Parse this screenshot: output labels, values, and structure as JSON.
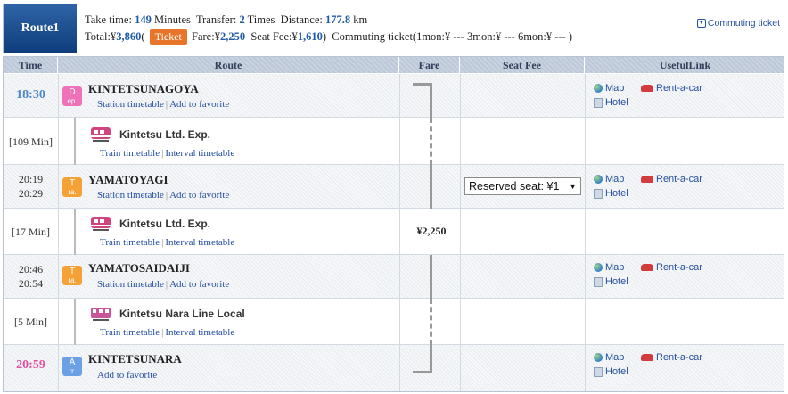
{
  "header": {
    "route_label": "Route1",
    "take_time_label": "Take time:",
    "take_time_value": "149",
    "minutes_label": "Minutes",
    "transfer_label": "Transfer:",
    "transfer_value": "2",
    "times_label": "Times",
    "distance_label": "Distance:",
    "distance_value": "177.8",
    "km_label": "km",
    "total_label": "Total:¥",
    "total_value": "3,860",
    "paren_open": "(",
    "ticket_button": "Ticket",
    "fare_label": "Fare:¥",
    "fare_value": "2,250",
    "seat_fee_label": "Seat Fee:¥",
    "seat_fee_value": "1,610",
    "paren_close": ")",
    "commuting_text": "Commuting ticket(1mon:¥ ---     3mon:¥ ---     6mon:¥ --- )",
    "commuting_link": "Commuting ticket"
  },
  "columns": [
    "Time",
    "Route",
    "Fare",
    "Seat Fee",
    "UsefulLink"
  ],
  "rows": {
    "dep": {
      "time": "18:30",
      "icon_top": "D",
      "icon_bottom": "ep.",
      "name": "KINTETSUNAGOYA",
      "link1": "Station timetable",
      "link2": "Add to favorite"
    },
    "t1": {
      "duration": "[109 Min]",
      "train": "Kintetsu Ltd. Exp.",
      "link1": "Train timetable",
      "link2": "Interval timetable"
    },
    "s2": {
      "time_arr": "20:19",
      "time_dep": "20:29",
      "icon_top": "T",
      "icon_bottom": "ra.",
      "name": "YAMATOYAGI",
      "link1": "Station timetable",
      "link2": "Add to favorite",
      "seat_select": "Reserved seat: ¥1"
    },
    "t2": {
      "duration": "[17 Min]",
      "train": "Kintetsu Ltd. Exp.",
      "link1": "Train timetable",
      "link2": "Interval timetable",
      "fare": "¥2,250"
    },
    "s3": {
      "time_arr": "20:46",
      "time_dep": "20:54",
      "icon_top": "T",
      "icon_bottom": "ra.",
      "name": "YAMATOSAIDAIJI",
      "link1": "Station timetable",
      "link2": "Add to favorite"
    },
    "t3": {
      "duration": "[5 Min]",
      "train": "Kintetsu Nara Line Local",
      "link1": "Train timetable",
      "link2": "Interval timetable"
    },
    "arr": {
      "time": "20:59",
      "icon_top": "A",
      "icon_bottom": "rr.",
      "name": "KINTETSUNARA",
      "link1": "Add to favorite"
    }
  },
  "useful": {
    "map": "Map",
    "rent": "Rent-a-car",
    "hotel": "Hotel"
  },
  "icons": {
    "globe": "globe-icon",
    "hotel": "hotel-icon",
    "car": "car-icon",
    "train_express": "train-icon",
    "train_local": "local-train-icon"
  },
  "colors": {
    "header_blue": "#1f5aa8",
    "ticket_orange": "#e8752a",
    "dep_pink": "#ee72b8",
    "tra_orange": "#f4a237",
    "arr_blue": "#6ba0e3",
    "arrival_time_pink": "#e04f9c",
    "departure_time_blue": "#4a87c4"
  }
}
